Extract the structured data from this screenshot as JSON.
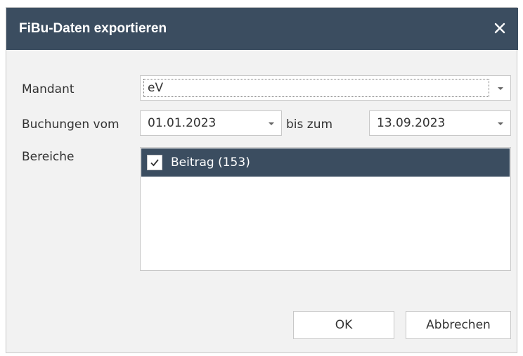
{
  "dialog": {
    "title": "FiBu-Daten exportieren",
    "close_icon": "close-icon"
  },
  "form": {
    "mandant_label": "Mandant",
    "mandant_value": "eV",
    "buchungen_label": "Buchungen vom",
    "from_date": "01.01.2023",
    "bis_label": "bis zum",
    "to_date": "13.09.2023",
    "bereiche_label": "Bereiche"
  },
  "bereiche": {
    "items": [
      {
        "label": "Beitrag (153)",
        "checked": true,
        "selected": true
      }
    ]
  },
  "buttons": {
    "ok": "OK",
    "cancel": "Abbrechen"
  },
  "colors": {
    "titlebar": "#3b4d60",
    "selection": "#3b4d60",
    "dialog_bg": "#f2f2f2"
  }
}
